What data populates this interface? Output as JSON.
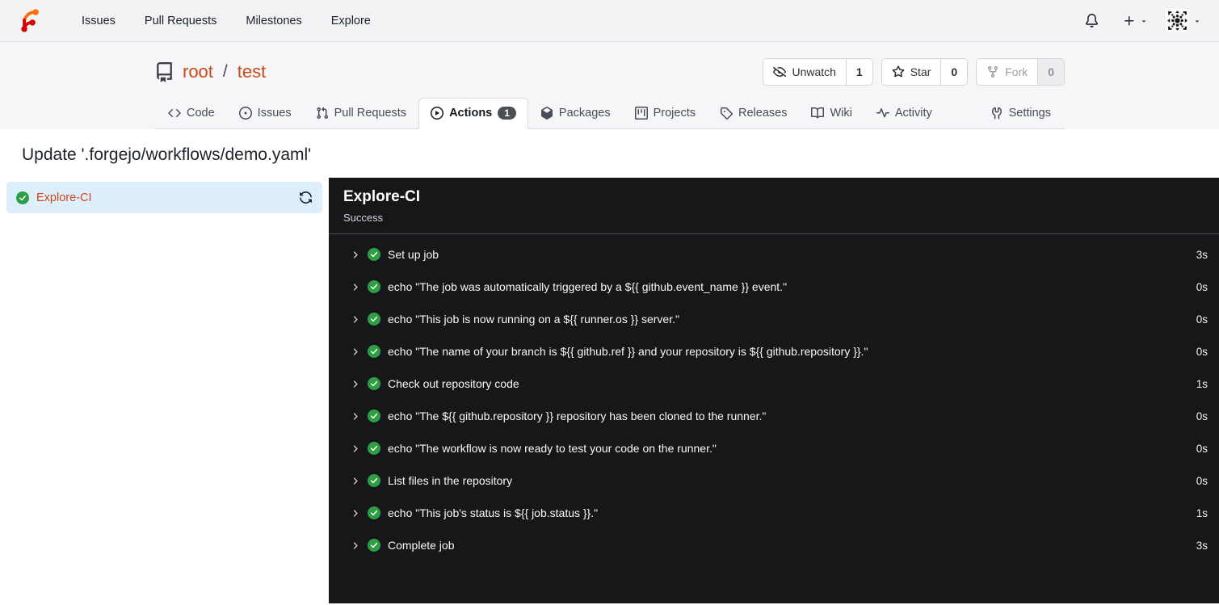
{
  "colors": {
    "accent": "#cc4a17",
    "success_green": "#2c9f45",
    "console_bg": "#17171a",
    "selected_job_bg": "#ddeffa"
  },
  "navbar": {
    "logo": "forgejo-logo",
    "links": [
      {
        "label": "Issues"
      },
      {
        "label": "Pull Requests"
      },
      {
        "label": "Milestones"
      },
      {
        "label": "Explore"
      }
    ],
    "right": {
      "bell": "bell-icon",
      "new": "plus-icon",
      "avatar": "user-avatar"
    }
  },
  "repo": {
    "icon": "repo-icon",
    "owner": "root",
    "separator": "/",
    "name": "test",
    "buttons": [
      {
        "id": "unwatch",
        "icon": "eye-off-icon",
        "label": "Unwatch",
        "count": "1",
        "disabled": false
      },
      {
        "id": "star",
        "icon": "star-icon",
        "label": "Star",
        "count": "0",
        "disabled": false
      },
      {
        "id": "fork",
        "icon": "fork-icon",
        "label": "Fork",
        "count": "0",
        "disabled": true
      }
    ],
    "tabs": [
      {
        "id": "code",
        "icon": "code-icon",
        "label": "Code"
      },
      {
        "id": "issues",
        "icon": "issue-opened-icon",
        "label": "Issues"
      },
      {
        "id": "pull-requests",
        "icon": "git-pull-request-icon",
        "label": "Pull Requests"
      },
      {
        "id": "actions",
        "icon": "play-icon",
        "label": "Actions",
        "badge": "1",
        "active": true
      },
      {
        "id": "packages",
        "icon": "package-icon",
        "label": "Packages"
      },
      {
        "id": "projects",
        "icon": "project-icon",
        "label": "Projects"
      },
      {
        "id": "releases",
        "icon": "tag-icon",
        "label": "Releases"
      },
      {
        "id": "wiki",
        "icon": "book-icon",
        "label": "Wiki"
      },
      {
        "id": "activity",
        "icon": "pulse-icon",
        "label": "Activity"
      },
      {
        "id": "settings",
        "icon": "tools-icon",
        "label": "Settings",
        "right": true
      }
    ]
  },
  "run": {
    "title": "Update '.forgejo/workflows/demo.yaml'",
    "jobs": [
      {
        "name": "Explore-CI",
        "status": "success",
        "status_icon": "check-circle-icon",
        "rerun_icon": "refresh-icon",
        "selected": true
      }
    ],
    "detail": {
      "job_name": "Explore-CI",
      "status_text": "Success",
      "steps": [
        {
          "name": "Set up job",
          "duration": "3s"
        },
        {
          "name": "echo \"The job was automatically triggered by a ${{ github.event_name }} event.\"",
          "duration": "0s"
        },
        {
          "name": "echo \"This job is now running on a ${{ runner.os }} server.\"",
          "duration": "0s"
        },
        {
          "name": "echo \"The name of your branch is ${{ github.ref }} and your repository is ${{ github.repository }}.\"",
          "duration": "0s"
        },
        {
          "name": "Check out repository code",
          "duration": "1s"
        },
        {
          "name": "echo \"The ${{ github.repository }} repository has been cloned to the runner.\"",
          "duration": "0s"
        },
        {
          "name": "echo \"The workflow is now ready to test your code on the runner.\"",
          "duration": "0s"
        },
        {
          "name": "List files in the repository",
          "duration": "0s"
        },
        {
          "name": "echo \"This job's status is ${{ job.status }}.\"",
          "duration": "1s"
        },
        {
          "name": "Complete job",
          "duration": "3s"
        }
      ]
    }
  }
}
